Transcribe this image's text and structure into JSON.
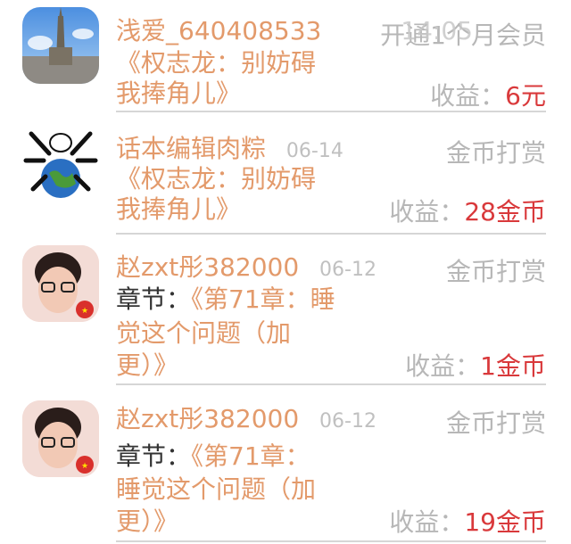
{
  "items": [
    {
      "name": "浅爱_640408533",
      "date": "14:05",
      "type": "开通1个月会员",
      "content_line1": "《权志龙：别妨碍",
      "content_line2": "我捧角儿》",
      "earn_label": "收益：",
      "earn_value": "6元"
    },
    {
      "name": "话本编辑肉粽",
      "date": "06-14",
      "type": "金币打赏",
      "content_line1": "《权志龙：别妨碍",
      "content_line2": "我捧角儿》",
      "earn_label": "收益：",
      "earn_value": "28金币"
    },
    {
      "name": "赵zxt彤382000",
      "date": "06-12",
      "type": "金币打赏",
      "chapter_label": "章节：",
      "content_line1": "《第71章：睡",
      "content_line2": "觉这个问题（加",
      "content_line3": "更）》",
      "earn_label": "收益：",
      "earn_value": "1金币"
    },
    {
      "name": "赵zxt彤382000",
      "date": "06-12",
      "type": "金币打赏",
      "chapter_label": "章节：",
      "content_line1": "《第71章：",
      "content_line2": "睡觉这个问题（加",
      "content_line3": "更）》",
      "earn_label": "收益：",
      "earn_value": "19金币"
    }
  ],
  "colors": {
    "accent_orange": "#e39a6b",
    "earn_red": "#d9393b",
    "muted_gray": "#b7b7b7",
    "separator": "#d6d6d6"
  }
}
